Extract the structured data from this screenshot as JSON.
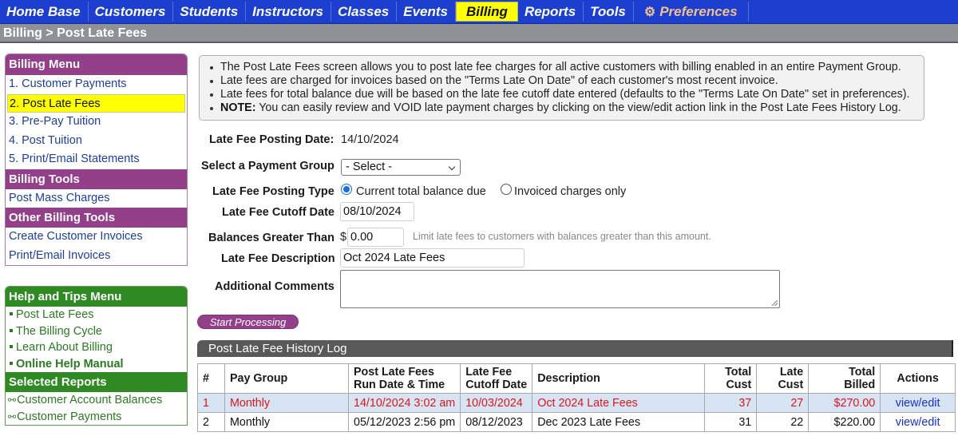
{
  "nav": {
    "items": [
      {
        "label": "Home Base",
        "active": false
      },
      {
        "label": "Customers",
        "active": false
      },
      {
        "label": "Students",
        "active": false
      },
      {
        "label": "Instructors",
        "active": false
      },
      {
        "label": "Classes",
        "active": false
      },
      {
        "label": "Events",
        "active": false
      },
      {
        "label": "Billing",
        "active": true
      },
      {
        "label": "Reports",
        "active": false
      },
      {
        "label": "Tools",
        "active": false
      }
    ],
    "preferences": {
      "label": "Preferences",
      "icon": "gear-icon",
      "glyph": "✱"
    },
    "colors": {
      "bar": "#1c3fcf",
      "active": "#ffff00",
      "preferences": "#f0c08e"
    }
  },
  "breadcrumb": "Billing > Post Late Fees",
  "sidebar": {
    "billing_menu": {
      "title": "Billing Menu",
      "items": [
        {
          "label": "1. Customer Payments",
          "active": false
        },
        {
          "label": "2. Post Late Fees",
          "active": true
        },
        {
          "label": "3. Pre-Pay Tuition",
          "active": false
        },
        {
          "label": "4. Post Tuition",
          "active": false
        },
        {
          "label": "5. Print/Email Statements",
          "active": false
        }
      ]
    },
    "billing_tools": {
      "title": "Billing Tools",
      "items": [
        {
          "label": "Post Mass Charges"
        }
      ]
    },
    "other_billing_tools": {
      "title": "Other Billing Tools",
      "items": [
        {
          "label": "Create Customer Invoices"
        },
        {
          "label": "Print/Email Invoices"
        }
      ]
    },
    "help_menu": {
      "title": "Help and Tips Menu",
      "items": [
        {
          "label": "Post Late Fees",
          "bold": false
        },
        {
          "label": "The Billing Cycle",
          "bold": false
        },
        {
          "label": "Learn About Billing",
          "bold": false
        },
        {
          "label": "Online Help Manual",
          "bold": true
        }
      ]
    },
    "selected_reports": {
      "title": "Selected Reports",
      "items": [
        {
          "label": "Customer Account Balances"
        },
        {
          "label": "Customer Payments"
        }
      ]
    }
  },
  "info": {
    "bullets": [
      {
        "bold": "",
        "text": "The Post Late Fees screen allows you to post late fee charges for all active customers with billing enabled in an entire Payment Group."
      },
      {
        "bold": "",
        "text": "Late fees are charged for invoices based on the \"Terms Late On Date\" of each customer's most recent invoice."
      },
      {
        "bold": "",
        "text": "Late fees for total balance due will be based on the late fee cutoff date entered (defaults to the \"Terms Late On Date\" set in preferences)."
      },
      {
        "bold": "NOTE:",
        "text": " You can easily review and VOID late payment charges by clicking on the view/edit action link in the Post Late Fees History Log."
      }
    ]
  },
  "form": {
    "posting_date_label": "Late Fee Posting Date:",
    "posting_date_value": "14/10/2024",
    "payment_group_label": "Select a Payment Group",
    "payment_group_value": "- Select -",
    "posting_type_label": "Late Fee Posting Type",
    "posting_type_options": [
      {
        "label": "Current total balance due",
        "checked": true
      },
      {
        "label": "Invoiced charges only",
        "checked": false
      }
    ],
    "cutoff_date_label": "Late Fee Cutoff Date",
    "cutoff_date_value": "08/10/2024",
    "balances_label": "Balances Greater Than",
    "currency_symbol": "$",
    "balances_value": "0.00",
    "balances_hint": "Limit late fees to customers with balances greater than this amount.",
    "description_label": "Late Fee Description",
    "description_value": "Oct 2024 Late Fees",
    "comments_label": "Additional Comments",
    "comments_value": "",
    "start_button": "Start Processing"
  },
  "history": {
    "title": "Post Late Fee History Log",
    "columns": [
      "#",
      "Pay Group",
      "Post Late Fees\nRun Date & Time",
      "Late Fee\nCutoff Date",
      "Description",
      "Total\nCust",
      "Late\nCust",
      "Total\nBilled",
      "Actions"
    ],
    "rows": [
      {
        "num": "1",
        "pay_group": "Monthly",
        "run_date": "14/10/2024 3:02 am",
        "cutoff": "10/03/2024",
        "description": "Oct 2024 Late Fees",
        "total_cust": "37",
        "late_cust": "27",
        "total_billed": "$270.00",
        "action": "view/edit",
        "highlighted": true
      },
      {
        "num": "2",
        "pay_group": "Monthly",
        "run_date": "05/12/2023 2:56 pm",
        "cutoff": "08/12/2023",
        "description": "Dec 2023 Late Fees",
        "total_cust": "31",
        "late_cust": "22",
        "total_billed": "$220.00",
        "action": "view/edit",
        "highlighted": false
      }
    ],
    "colors": {
      "highlight_bg": "#d6e4f3",
      "highlight_text": "#e0151b",
      "link": "#1a2fd0"
    }
  }
}
